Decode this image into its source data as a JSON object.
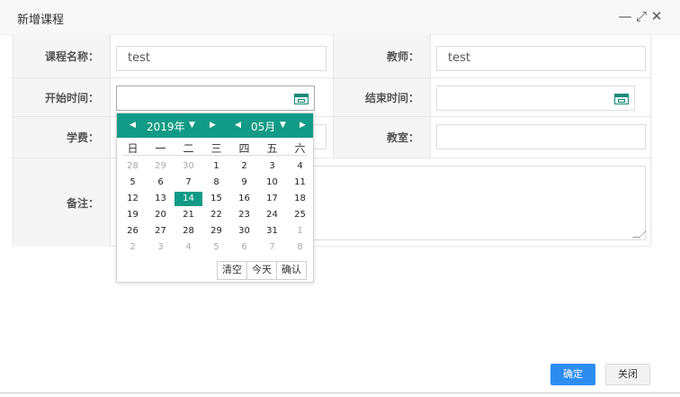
{
  "dialog": {
    "title": "新增课程",
    "minimize_glyph": "—",
    "maximize_glyph": "⤢",
    "close_glyph": "✕"
  },
  "form": {
    "course_name_label": "课程名称：",
    "course_name_value": "test",
    "teacher_label": "教师：",
    "teacher_value": "test",
    "start_time_label": "开始时间：",
    "start_time_value": "",
    "end_time_label": "结束时间：",
    "end_time_value": "",
    "fee_label": "学费：",
    "fee_value": "",
    "classroom_label": "教室：",
    "classroom_value": "",
    "remark_label": "备注：",
    "remark_value": ""
  },
  "calendar": {
    "year_label": "2019年",
    "month_label": "05月",
    "weekdays": [
      "日",
      "一",
      "二",
      "三",
      "四",
      "五",
      "六"
    ],
    "weeks": [
      [
        "28",
        "29",
        "30",
        "1",
        "2",
        "3",
        "4"
      ],
      [
        "5",
        "6",
        "7",
        "8",
        "9",
        "10",
        "11"
      ],
      [
        "12",
        "13",
        "14",
        "15",
        "16",
        "17",
        "18"
      ],
      [
        "19",
        "20",
        "21",
        "22",
        "23",
        "24",
        "25"
      ],
      [
        "26",
        "27",
        "28",
        "29",
        "30",
        "31",
        "1"
      ],
      [
        "2",
        "3",
        "4",
        "5",
        "6",
        "7",
        "8"
      ]
    ],
    "selected_day": "14",
    "clear_label": "清空",
    "today_label": "今天",
    "confirm_label": "确认"
  },
  "footer": {
    "ok_label": "确定",
    "close_label": "关闭"
  },
  "colors": {
    "accent": "#119b86",
    "primary_button": "#2d8cf0"
  }
}
